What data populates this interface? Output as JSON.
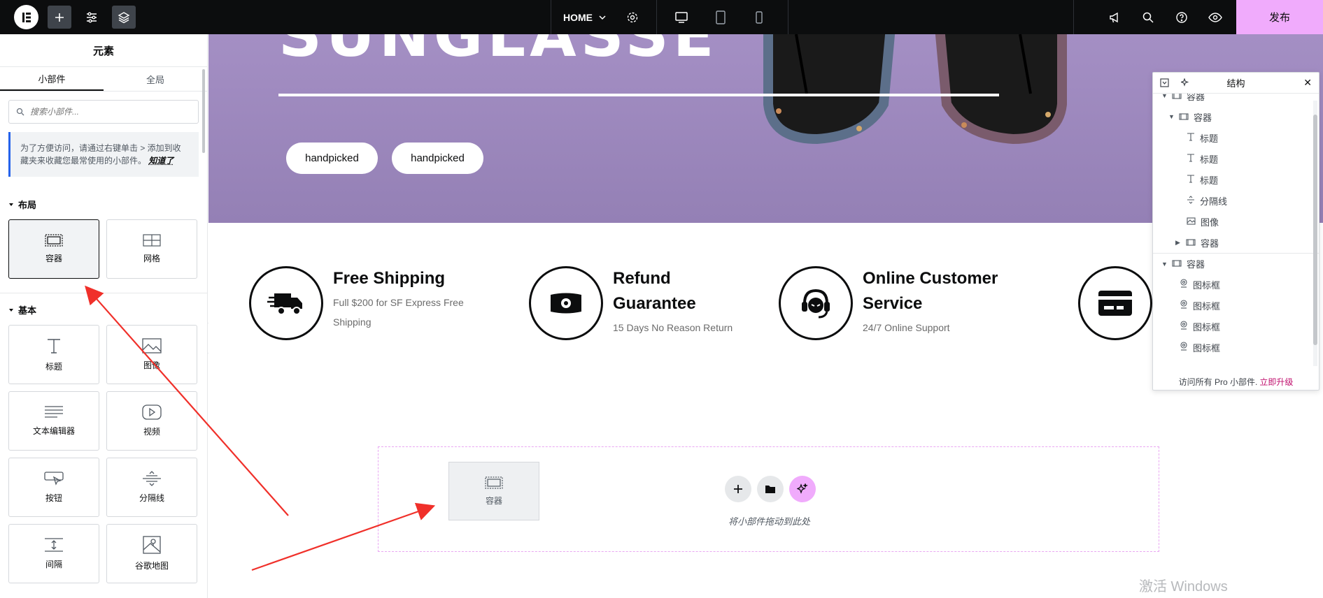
{
  "topbar": {
    "page_name": "HOME",
    "publish_label": "发布"
  },
  "panel": {
    "title": "元素",
    "tabs": [
      "小部件",
      "全局"
    ],
    "search_placeholder": "搜索小部件...",
    "notice_text": "为了方便访问，请通过右键单击 > 添加到收藏夹来收藏您最常使用的小部件。",
    "notice_link": "知道了",
    "sections": [
      {
        "title": "布局",
        "widgets": [
          {
            "label": "容器",
            "icon": "container-icon"
          },
          {
            "label": "网格",
            "icon": "grid-icon"
          }
        ]
      },
      {
        "title": "基本",
        "widgets": [
          {
            "label": "标题",
            "icon": "heading-icon"
          },
          {
            "label": "图像",
            "icon": "image-icon"
          },
          {
            "label": "文本编辑器",
            "icon": "text-editor-icon"
          },
          {
            "label": "视频",
            "icon": "video-icon"
          },
          {
            "label": "按钮",
            "icon": "button-icon"
          },
          {
            "label": "分隔线",
            "icon": "divider-icon"
          },
          {
            "label": "间隔",
            "icon": "spacer-icon"
          },
          {
            "label": "谷歌地图",
            "icon": "google-maps-icon"
          }
        ]
      }
    ]
  },
  "hero": {
    "title": "SUNGLASSE",
    "pills": [
      "handpicked",
      "handpicked"
    ]
  },
  "features": [
    {
      "title_lines": [
        "Free Shipping"
      ],
      "sub_lines": [
        "Full $200 for SF Express Free",
        "Shipping"
      ],
      "icon": "delivery-truck-icon"
    },
    {
      "title_lines": [
        "Refund",
        "Guarantee"
      ],
      "sub_lines": [
        "15 Days No Reason Return"
      ],
      "icon": "money-icon"
    },
    {
      "title_lines": [
        "Online Customer",
        "Service"
      ],
      "sub_lines": [
        "24/7 Online Support"
      ],
      "icon": "headset-support-icon"
    },
    {
      "title_lines": [],
      "sub_lines": [],
      "icon": "credit-card-icon"
    }
  ],
  "dropzone": {
    "drag_item_label": "容器",
    "drop_text": "将小部件拖动到此处"
  },
  "structure": {
    "title": "结构",
    "nodes": [
      {
        "label": "容器",
        "level": 0,
        "arrow": "down",
        "type": "container"
      },
      {
        "label": "容器",
        "level": 1,
        "arrow": "down",
        "type": "container"
      },
      {
        "label": "标题",
        "level": 2,
        "arrow": "",
        "type": "heading"
      },
      {
        "label": "标题",
        "level": 2,
        "arrow": "",
        "type": "heading"
      },
      {
        "label": "标题",
        "level": 2,
        "arrow": "",
        "type": "heading"
      },
      {
        "label": "分隔线",
        "level": 2,
        "arrow": "",
        "type": "divider"
      },
      {
        "label": "图像",
        "level": 2,
        "arrow": "",
        "type": "image"
      },
      {
        "label": "容器",
        "level": 2,
        "arrow": "right",
        "type": "container"
      },
      {
        "label": "容器",
        "level": 0,
        "arrow": "down",
        "type": "container"
      },
      {
        "label": "图标框",
        "level": 1,
        "arrow": "",
        "type": "icon-box"
      },
      {
        "label": "图标框",
        "level": 1,
        "arrow": "",
        "type": "icon-box"
      },
      {
        "label": "图标框",
        "level": 1,
        "arrow": "",
        "type": "icon-box"
      },
      {
        "label": "图标框",
        "level": 1,
        "arrow": "",
        "type": "icon-box"
      }
    ],
    "footer_text": "访问所有 Pro 小部件.",
    "footer_link": "立即升级",
    "dots": "···"
  },
  "watermark": {
    "line1": "激活 Windows"
  },
  "colors": {
    "topbar_bg": "#0c0d0e",
    "publish_bg": "#f0abfc",
    "hero_bg": "#a48fc4",
    "annotation_arrow": "#f0302a",
    "upgrade_link": "#c0116e"
  }
}
